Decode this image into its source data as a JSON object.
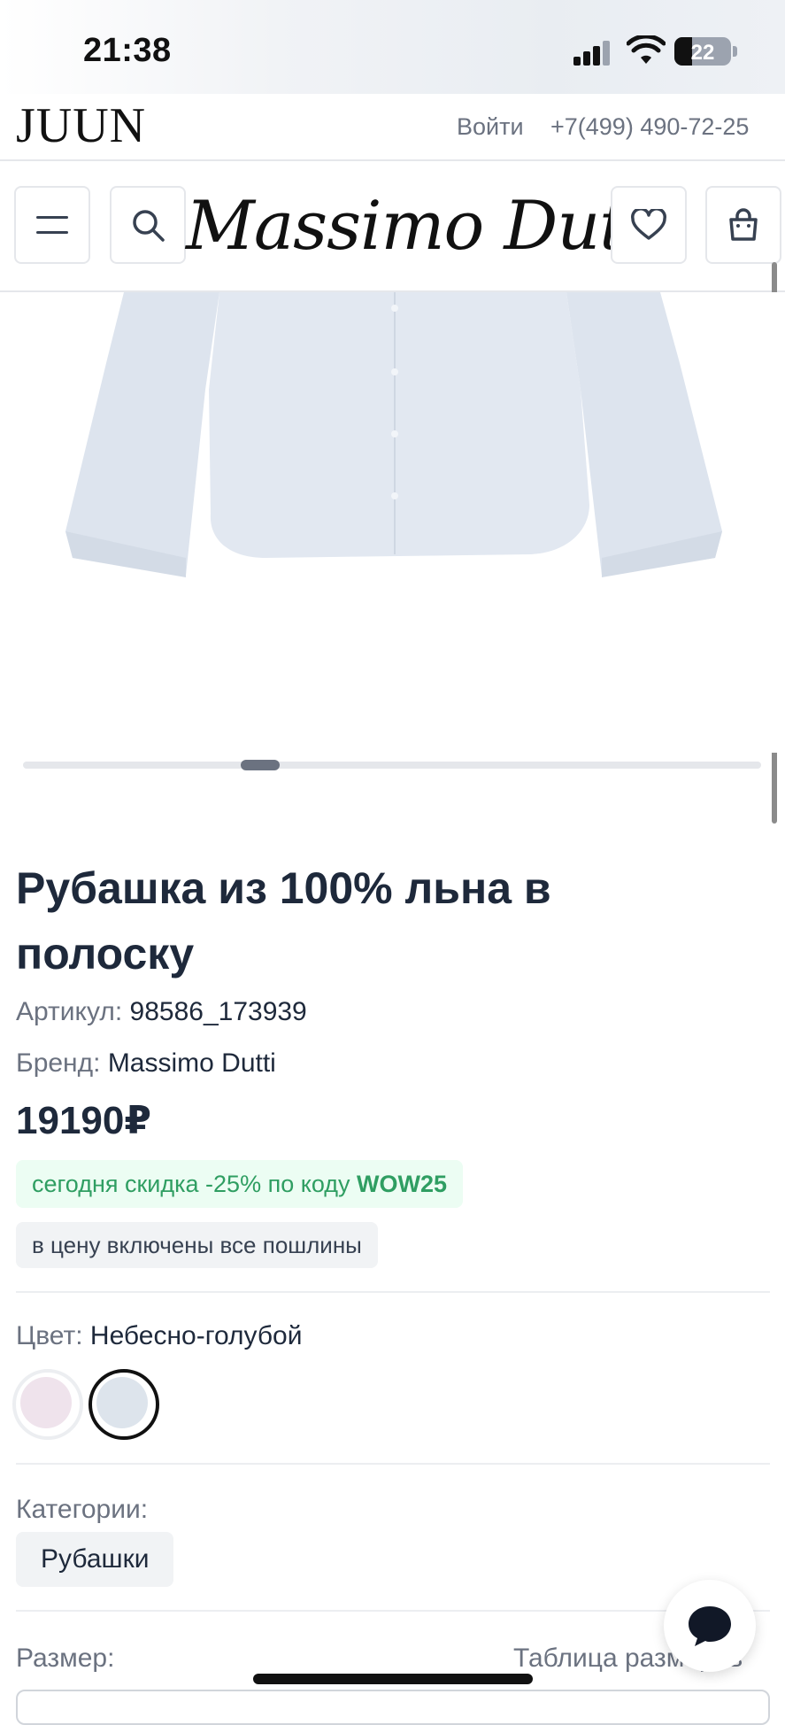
{
  "status_bar": {
    "time": "21:38",
    "battery": "22"
  },
  "top_bar": {
    "shop_logo": "JUUN",
    "login": "Войти",
    "phone": "+7(499) 490-72-25"
  },
  "brand_bar": {
    "brand_logo": "Massimo Dutti",
    "icons": [
      "menu-icon",
      "search-icon",
      "heart-icon",
      "bag-icon"
    ]
  },
  "product": {
    "title": "Рубашка из 100% льна в полоску",
    "sku_label": "Артикул:",
    "sku": "98586_173939",
    "brand_label": "Бренд:",
    "brand": "Massimo Dutti",
    "price": "19190₽",
    "promo_text": "сегодня скидка -25% по коду",
    "promo_code": "WOW25",
    "duty_note": "в цену включены все пошлины",
    "color_label": "Цвет:",
    "color_value": "Небесно-голубой",
    "swatches": [
      {
        "color": "#efe3ec",
        "selected": false
      },
      {
        "color": "#dde4ec",
        "selected": true
      }
    ],
    "categories_label": "Категории:",
    "category": "Рубашки",
    "size_label": "Размер:",
    "size_table": "Таблица размеров"
  },
  "colors": {
    "text_dark": "#1e293b",
    "text_muted": "#6b7280",
    "promo_green": "#2f9e62",
    "promo_bg": "#ecfdf3",
    "shirt": "#dde4ee"
  }
}
